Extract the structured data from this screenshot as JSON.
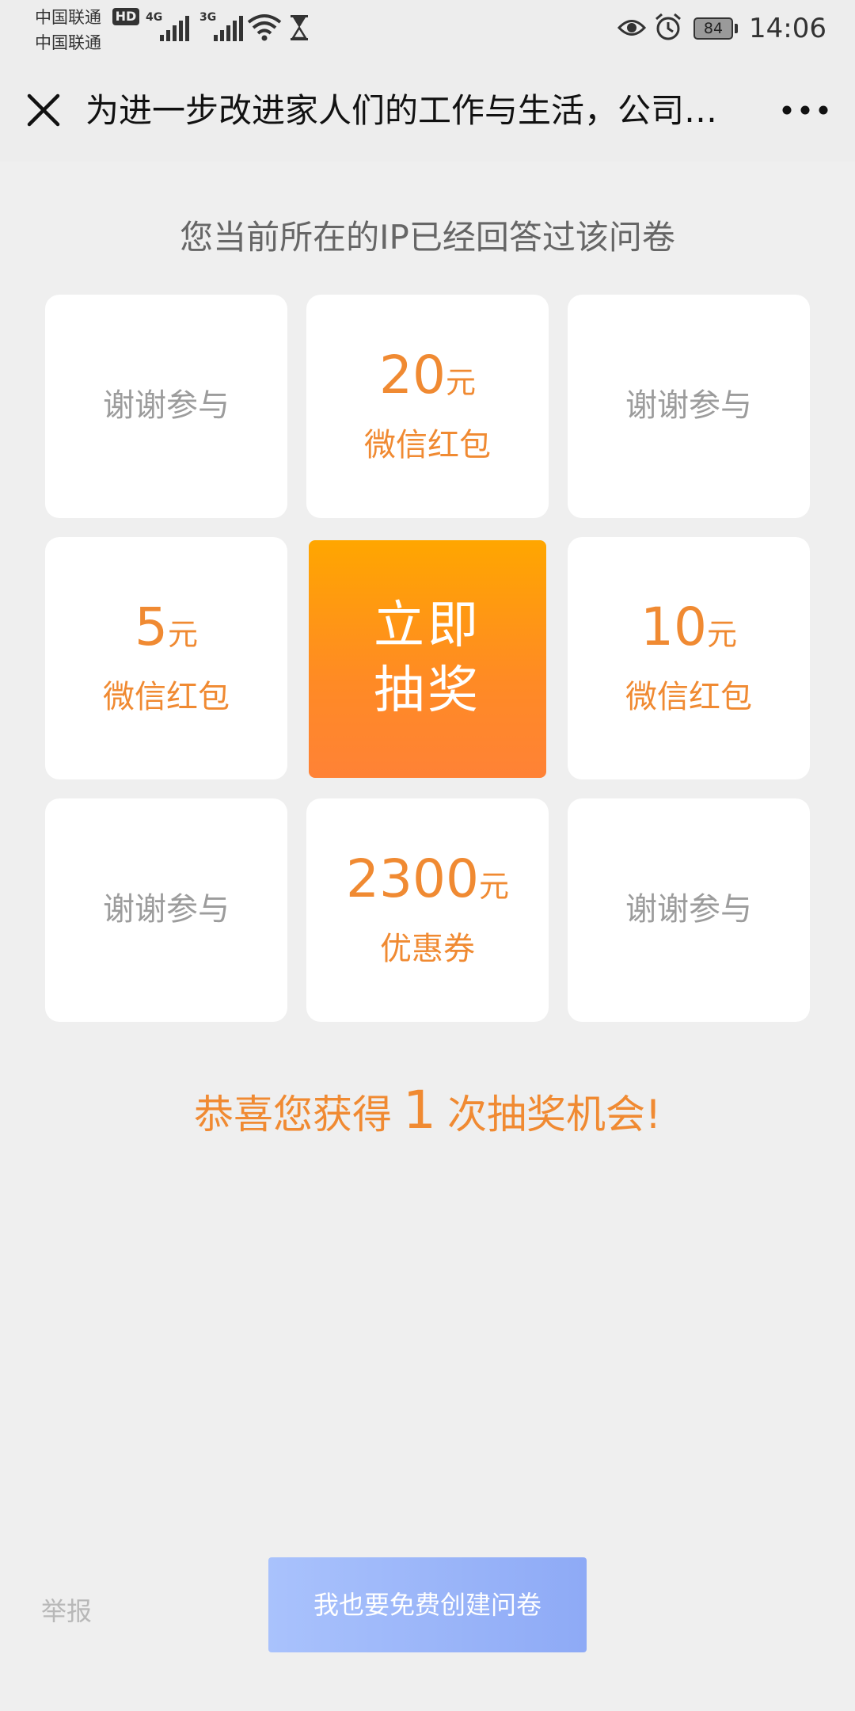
{
  "status_bar": {
    "carrier_1": "中国联通",
    "carrier_2": "中国联通",
    "hd_badge": "HD",
    "network_1": "4G",
    "network_2": "3G",
    "battery_level": "84",
    "time": "14:06"
  },
  "nav": {
    "title": "为进一步改进家人们的工作与生活，公司…",
    "close_icon": "close-icon",
    "more_icon": "more-dots-icon"
  },
  "notice": "您当前所在的IP已经回答过该问卷",
  "lottery": {
    "cells": [
      {
        "type": "thanks",
        "text": "谢谢参与"
      },
      {
        "type": "prize",
        "amount": "20",
        "unit": "元",
        "name": "微信红包"
      },
      {
        "type": "thanks",
        "text": "谢谢参与"
      },
      {
        "type": "prize",
        "amount": "5",
        "unit": "元",
        "name": "微信红包"
      },
      {
        "type": "draw",
        "line1": "立即",
        "line2": "抽奖"
      },
      {
        "type": "prize",
        "amount": "10",
        "unit": "元",
        "name": "微信红包"
      },
      {
        "type": "thanks",
        "text": "谢谢参与"
      },
      {
        "type": "prize",
        "amount": "2300",
        "unit": "元",
        "name": "优惠券"
      },
      {
        "type": "thanks",
        "text": "谢谢参与"
      }
    ]
  },
  "congrats": {
    "prefix": "恭喜您获得",
    "count": "1",
    "suffix": "次抽奖机会!"
  },
  "footer": {
    "report": "举报",
    "create_button": "我也要免费创建问卷"
  },
  "colors": {
    "accent_orange": "#f08a32",
    "draw_gradient_top": "#ffa600",
    "draw_gradient_bottom": "#ff8236",
    "create_button": "#9bb6f9",
    "background": "#efefef"
  }
}
